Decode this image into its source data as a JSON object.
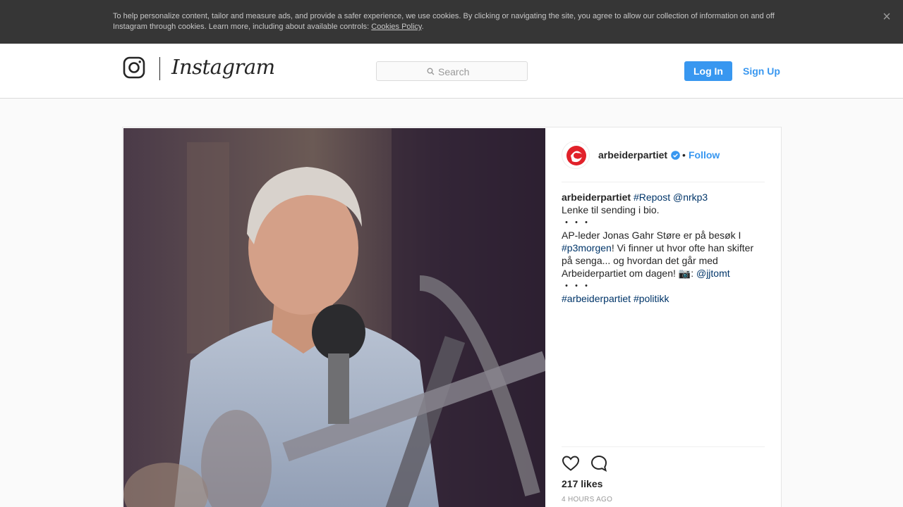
{
  "cookie_banner": {
    "text": "To help personalize content, tailor and measure ads, and provide a safer experience, we use cookies. By clicking or navigating the site, you agree to allow our collection of information on and off Instagram through cookies. Learn more, including about available controls: ",
    "link": "Cookies Policy",
    "suffix": ".",
    "close_icon": "close-icon"
  },
  "header": {
    "logo_text": "Instagram",
    "search_placeholder": "Search",
    "login_label": "Log In",
    "signup_label": "Sign Up"
  },
  "post": {
    "username": "arbeiderpartiet",
    "separator": "•",
    "follow_label": "Follow",
    "caption": {
      "author": "arbeiderpartiet",
      "tag_repost": "#Repost",
      "mention_nrk": "@nrkp3",
      "line2": "Lenke til sending i bio.",
      "dots1": "・・・",
      "line4a": "AP-leder Jonas Gahr Støre er på besøk I",
      "tag_p3": "#p3morgen",
      "line4b": "! Vi finner ut hvor ofte han skifter på senga... og hvordan det går med Arbeiderpartiet om dagen! 📷: ",
      "mention_jj": "@jjtomt",
      "dots2": "・・・",
      "tag_ap": "#arbeiderpartiet",
      "tag_politikk": "#politikk"
    },
    "likes": "217 likes",
    "time": "4 HOURS AGO"
  },
  "colors": {
    "accent": "#3897f0",
    "hashtag": "#003569",
    "banner": "#363636"
  }
}
